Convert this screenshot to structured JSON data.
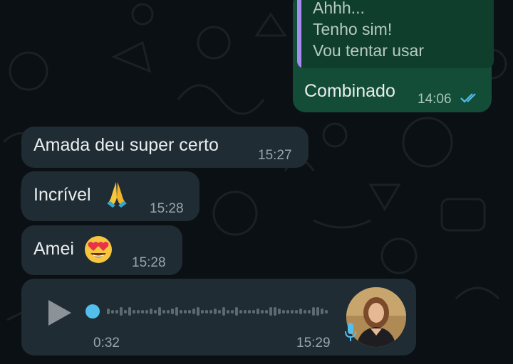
{
  "outgoing": {
    "quoted_lines": [
      "Ahhh...",
      "Tenho sim!",
      "Vou tentar usar"
    ],
    "text": "Combinado",
    "time": "14:06",
    "status_icon": "double-check-read-icon"
  },
  "incoming": [
    {
      "text": "Amada deu super certo",
      "time": "15:27"
    },
    {
      "text": "Incrível",
      "emoji": "folded-hands-icon",
      "time": "15:28"
    },
    {
      "text": "Amei",
      "emoji": "heart-eyes-face-icon",
      "time": "15:28"
    }
  ],
  "voice_note": {
    "duration": "0:32",
    "time": "15:29",
    "progress": 0,
    "play_icon": "play-icon",
    "mic_icon": "microphone-icon",
    "avatar": "sender-avatar"
  },
  "colors": {
    "background": "#0b1014",
    "incoming_bubble": "#202c33",
    "outgoing_bubble": "#144d37",
    "read_check": "#53bdeb",
    "quote_bar": "#a58cf1"
  }
}
